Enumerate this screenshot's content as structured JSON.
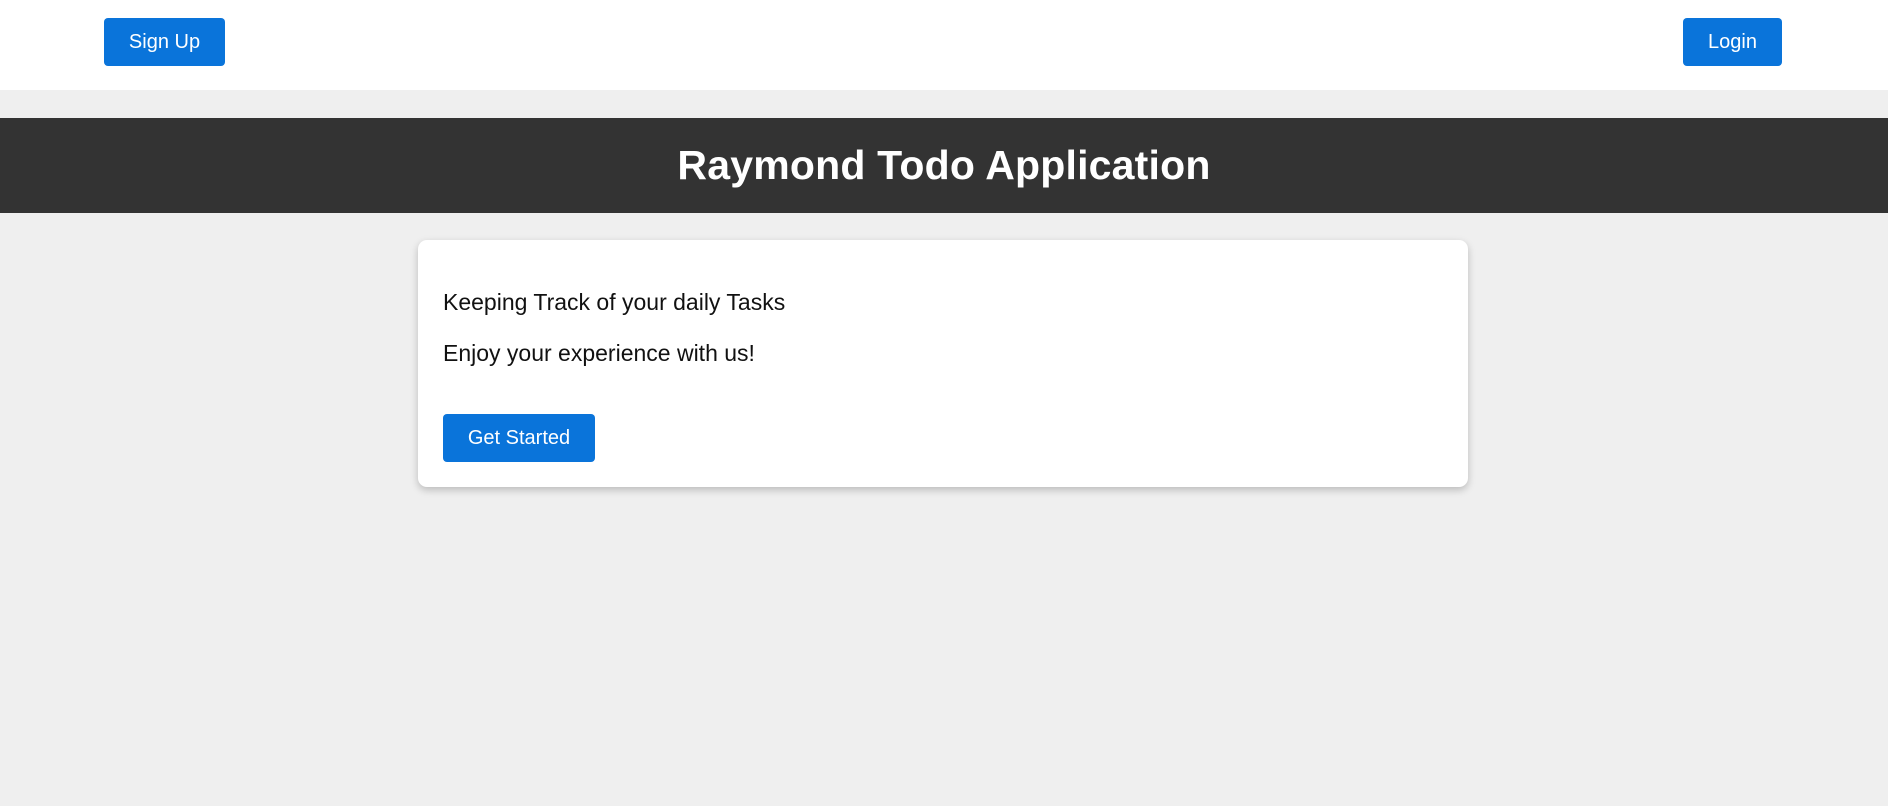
{
  "nav": {
    "signup_label": "Sign Up",
    "login_label": "Login"
  },
  "header": {
    "title": "Raymond Todo Application"
  },
  "card": {
    "line1": "Keeping Track of your daily Tasks",
    "line2": "Enjoy your experience with us!",
    "cta_label": "Get Started"
  },
  "colors": {
    "accent": "#0a74da",
    "banner": "#333333",
    "background": "#efefef"
  }
}
